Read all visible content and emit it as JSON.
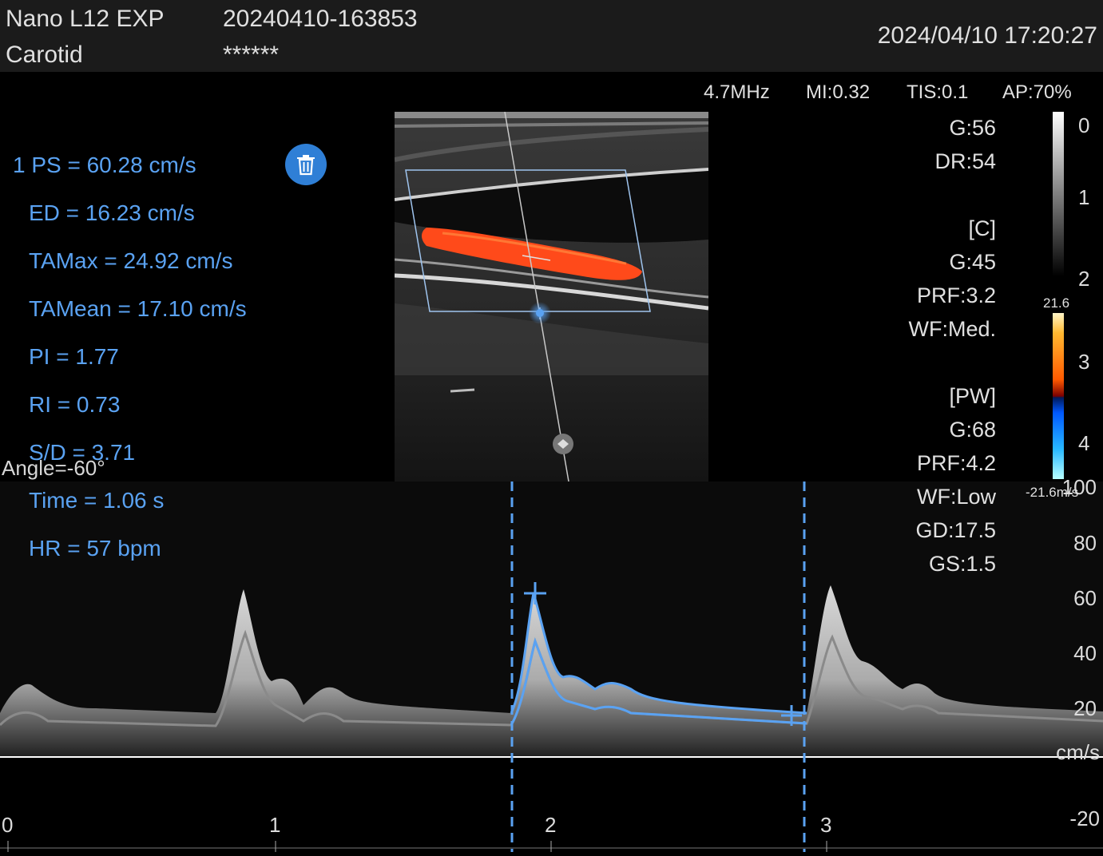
{
  "header": {
    "probe": "Nano L12 EXP",
    "preset": "Carotid",
    "exam_id": "20240410-163853",
    "patient": "******",
    "datetime": "2024/04/10 17:20:27"
  },
  "acoustic": {
    "freq": "4.7MHz",
    "mi": "MI:0.32",
    "tis": "TIS:0.1",
    "ap": "AP:70%"
  },
  "bmode_params": {
    "orientation": "E",
    "g": "G:56",
    "dr": "DR:54",
    "color_hdr": "[C]",
    "color_g": "G:45",
    "color_prf": "PRF:3.2",
    "color_wf": "WF:Med.",
    "pw_hdr": "[PW]",
    "pw_g": "G:68",
    "pw_prf": "PRF:4.2",
    "pw_wf": "WF:Low",
    "gd": "GD:17.5",
    "gs": "GS:1.5"
  },
  "measurements": {
    "ps": "1 PS = 60.28 cm/s",
    "ed": "ED = 16.23 cm/s",
    "tamax": "TAMax = 24.92 cm/s",
    "tamean": "TAMean = 17.10 cm/s",
    "pi": "PI = 1.77",
    "ri": "RI = 0.73",
    "sd": "S/D = 3.71",
    "time": "Time = 1.06 s",
    "hr": "HR = 57 bpm",
    "delete_icon": "trash-icon"
  },
  "angle": "Angle=-60°",
  "depth_scale": {
    "ticks": [
      "0",
      "1",
      "2",
      "3",
      "4"
    ]
  },
  "color_scale": {
    "max": "21.6",
    "min": "-21.6m/s"
  },
  "velocity_scale": {
    "ticks": [
      "100",
      "80",
      "60",
      "40",
      "20",
      "-20"
    ],
    "unit": "cm/s"
  },
  "time_scale": {
    "ticks": [
      "0",
      "1",
      "2",
      "3"
    ]
  },
  "colors": {
    "measurement": "#5aa2f2",
    "accent": "#2f7fd6",
    "text": "#e0e0e0"
  }
}
